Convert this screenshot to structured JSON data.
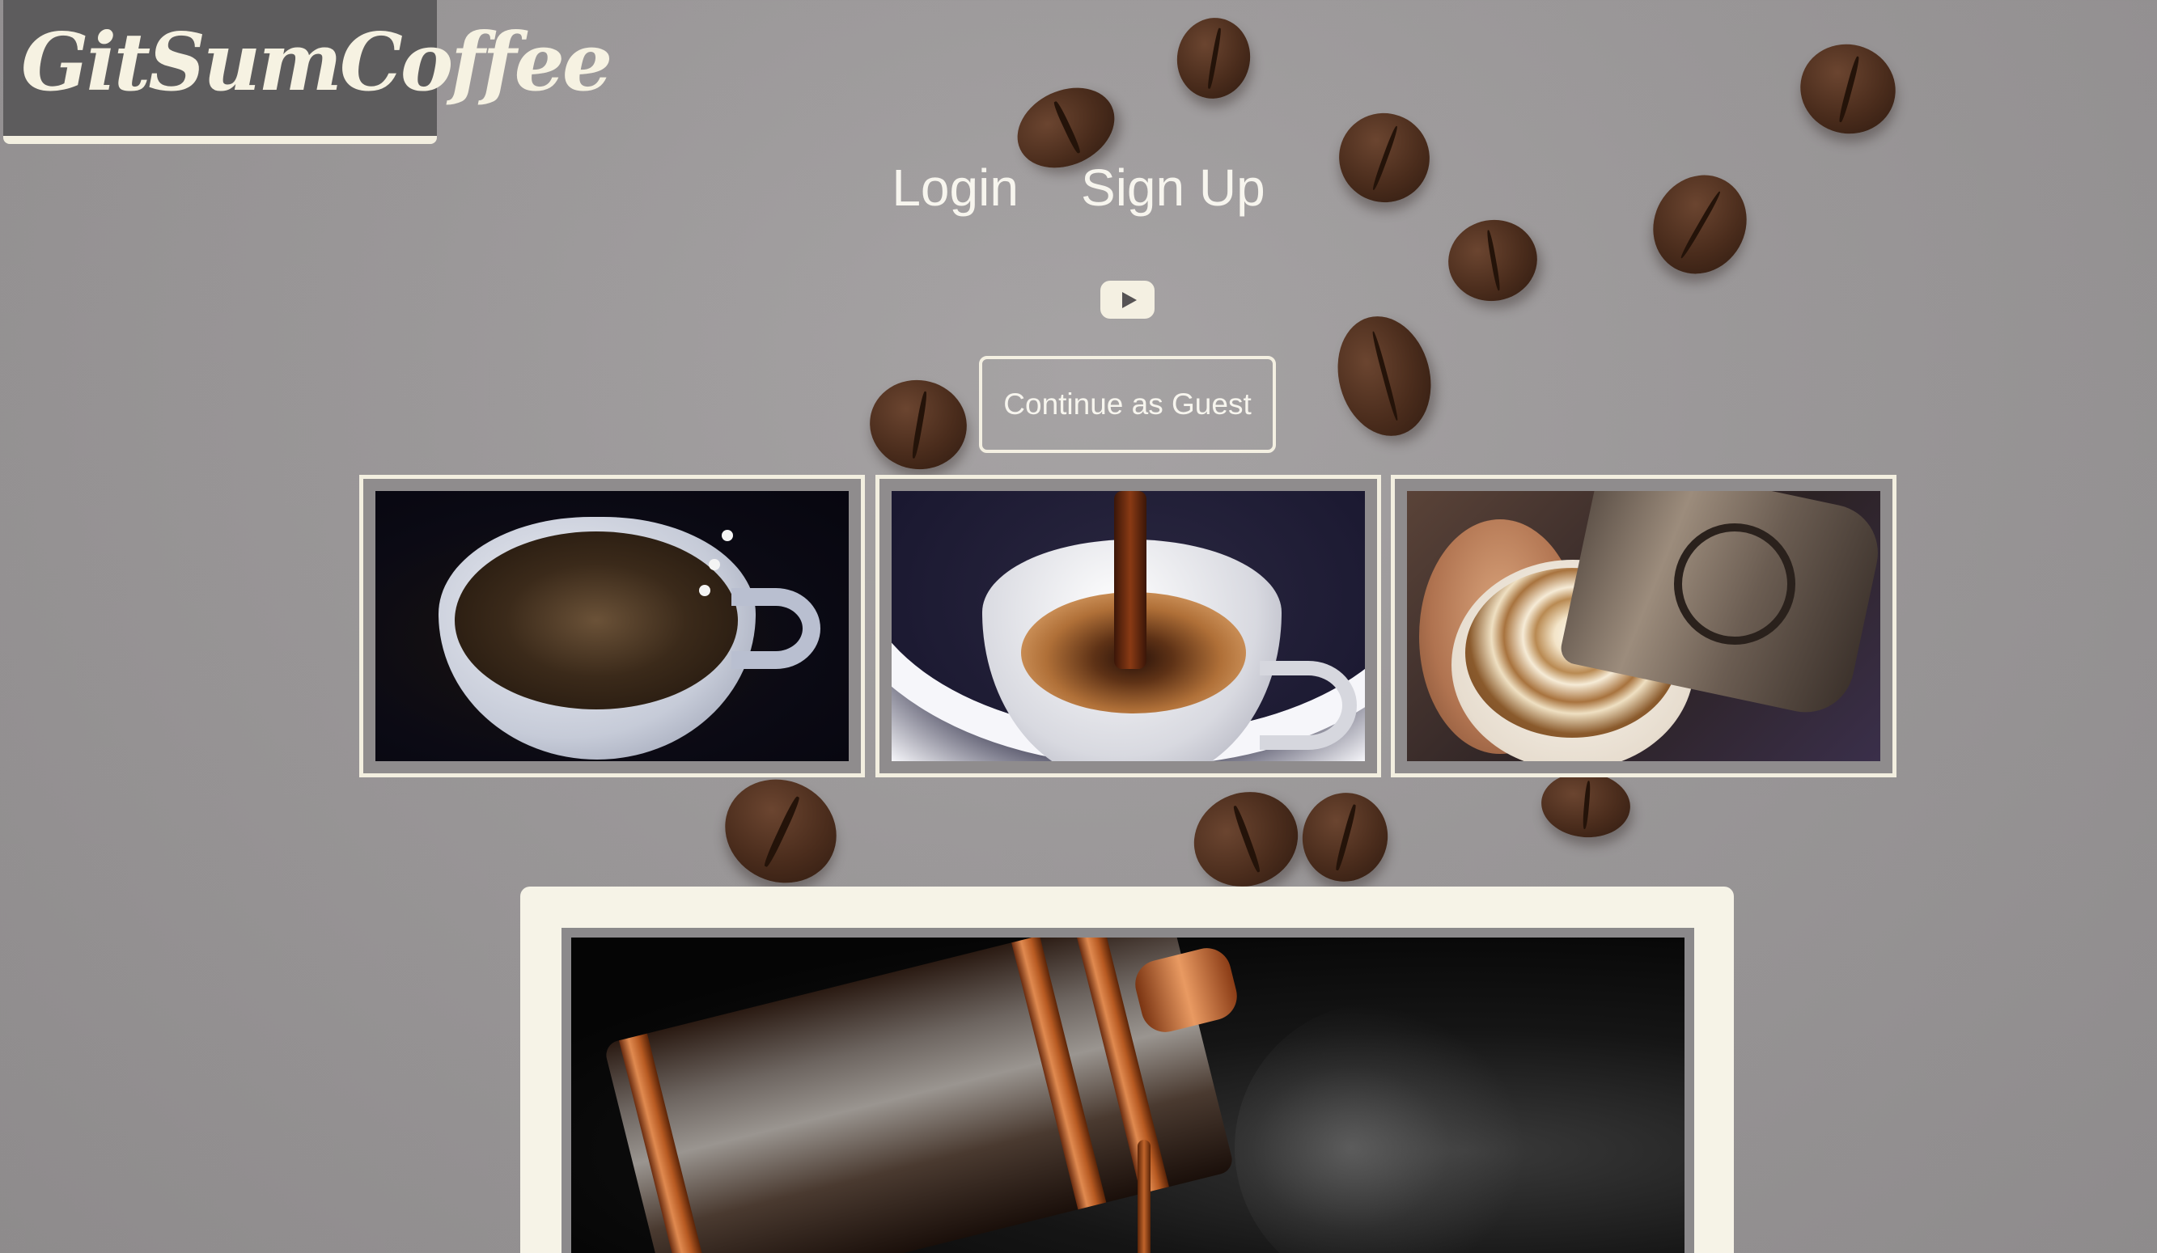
{
  "brand": {
    "name": "GitSumCoffee"
  },
  "nav": {
    "login_label": "Login",
    "signup_label": "Sign Up"
  },
  "video": {
    "icon": "youtube-play-icon"
  },
  "guest_button": {
    "label": "Continue as Guest"
  },
  "gallery": {
    "images": [
      {
        "name": "coffee-cup-milk-drops-image"
      },
      {
        "name": "espresso-pour-image"
      },
      {
        "name": "latte-art-pour-image"
      }
    ]
  },
  "feature": {
    "image": "french-press-pour-image"
  },
  "colors": {
    "accent": "#f3efe0",
    "logo_bg": "#5d5c5d",
    "text": "#f7f5ee"
  }
}
